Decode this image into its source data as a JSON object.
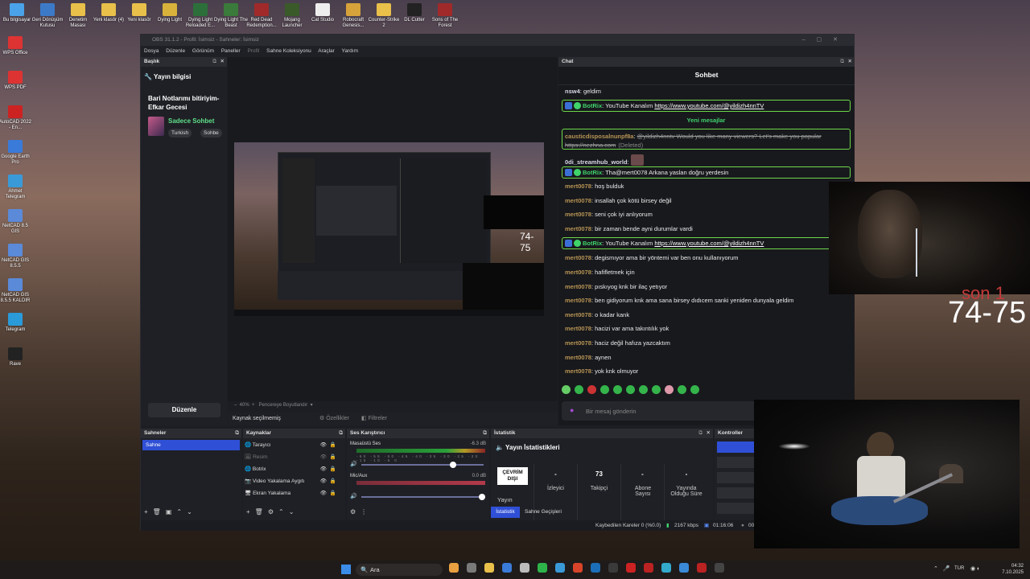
{
  "desktop": {
    "top_icons": [
      "Bu bilgisayar",
      "Geri Dönüşüm Kutusu",
      "Denetim Masası",
      "Yeni klasör (4)",
      "Yeni klasör",
      "Dying Light",
      "Dying Light Reloaded E...",
      "Dying Light The Beast",
      "Red Dead Redemption...",
      "Mojang Launcher",
      "Cat Studio",
      "Robocraft Genesis...",
      "Counter-Strike 2",
      "DL Cutter",
      "Sons of The Forest"
    ],
    "left_icons": [
      "WPS Office",
      "WPS PDF",
      "AutoCAD 2022 - En...",
      "Google Earth Pro",
      "Ahmet Telegram",
      "NetCAD 8.5 GIS",
      "NetCAD GIS 8.5.5",
      "NetCAD GIS 8.5.5 KALDIR",
      "Telegram",
      "Rave"
    ]
  },
  "obs": {
    "title": "OBS 31.1.2 - Profil: İsimsiz - Sahneler: İsimsiz",
    "menu": [
      "Dosya",
      "Düzenle",
      "Görünüm",
      "Paneller",
      "Profil",
      "Sahne Koleksiyonu",
      "Araçlar",
      "Yardım"
    ],
    "left_dock": {
      "header": "Başlık",
      "section_title": "Yayın bilgisi",
      "stream_title": "Bari Notlarımı bitiriyim-Efkar Gecesi",
      "category": "Sadece Sohbet",
      "tags": [
        "Turkish",
        "Sohbe"
      ],
      "edit_button": "Düzenle"
    },
    "preview": {
      "overlay_text": "74-75",
      "zoom": "40%",
      "fit_label": "Pencereye Boyutlandır",
      "no_source": "Kaynak seçilmemiş",
      "properties": "Özellikler",
      "filters": "Filtreler"
    },
    "chat": {
      "header": "Chat",
      "title": "Sohbet",
      "new_messages": "Yeni mesajlar",
      "input_placeholder": "Bir mesaj gönderin",
      "messages": [
        {
          "user": "nsw4",
          "text": "geldim"
        },
        {
          "user": "BotRix",
          "text": "YouTube Kanalım ",
          "link": "https://www.youtube.com/@yildizh4nnTV"
        },
        {
          "user": "causticdisposalnunpf8a",
          "text": "@yildizh4nntv Would you like many viewers? Let's make you popular https://nezhna.com",
          "note": "(Deleted)"
        },
        {
          "user": "0di_streamhub_world",
          "text": ""
        },
        {
          "user": "BotRix",
          "text": "Tha@mert0078 Arkana yaslan doğru yerdesin"
        },
        {
          "user": "mert0078",
          "text": "hoş bulduk"
        },
        {
          "user": "mert0078",
          "text": "insallah çok kötü birsey değil"
        },
        {
          "user": "mert0078",
          "text": "seni çok iyi anlıyorum"
        },
        {
          "user": "mert0078",
          "text": "bir zaman bende ayni durumlar vardi"
        },
        {
          "user": "BotRix",
          "text": "YouTube Kanalım ",
          "link": "https://www.youtube.com/@yildizh4nnTV"
        },
        {
          "user": "mert0078",
          "text": "degismıyor ama bir yöntemi var ben onu kullanıyorum"
        },
        {
          "user": "mert0078",
          "text": "hafifletmek için"
        },
        {
          "user": "mert0078",
          "text": "pıskıyog knk bir ilaç yetıyor"
        },
        {
          "user": "mert0078",
          "text": "ben gidiyorum knk ama sana birsey dıdıcem sanki yeniden dunyala geldim"
        },
        {
          "user": "mert0078",
          "text": "o kadar kank"
        },
        {
          "user": "mert0078",
          "text": "hacizi var ama takıntılık yok"
        },
        {
          "user": "mert0078",
          "text": "haciz değil hafıza yazcaktım"
        },
        {
          "user": "mert0078",
          "text": "aynen"
        },
        {
          "user": "mert0078",
          "text": "yok knk olmuyor"
        }
      ]
    },
    "scenes": {
      "header": "Sahneler",
      "items": [
        "Sahne"
      ]
    },
    "sources": {
      "header": "Kaynaklar",
      "items": [
        "Tarayıcı",
        "Resim",
        "Botrix",
        "Video Yakalama Aygıtı",
        "Ekran Yakalama"
      ]
    },
    "mixer": {
      "header": "Ses Karıştırıcı",
      "channels": [
        {
          "name": "Masaüstü Ses",
          "db": "-6.3 dB"
        },
        {
          "name": "Mic/Aux",
          "db": "0.0 dB"
        }
      ],
      "ticks": [
        "-60",
        "-55",
        "-50",
        "-45",
        "-40",
        "-35",
        "-30",
        "-25",
        "-20",
        "-15",
        "-10",
        "-5",
        "0"
      ]
    },
    "stats": {
      "header": "İstatistik",
      "title": "Yayın İstatistikleri",
      "offline": "ÇEVRİM DIŞI",
      "items": [
        {
          "label": "Yayın",
          "value": ""
        },
        {
          "label": "İzleyici",
          "value": "-"
        },
        {
          "label": "Takipçi",
          "value": "73"
        },
        {
          "label": "Abone Sayısı",
          "value": "-"
        },
        {
          "label": "Yayında Olduğu Süre",
          "value": "-"
        }
      ],
      "tabs": [
        "İstatistik",
        "Sahne Geçişleri"
      ]
    },
    "controls": {
      "header": "Kontroller"
    },
    "statusbar": {
      "dropped": "Kaybedilen Kareler 0 (%0.0)",
      "kbps": "2167 kbps",
      "time": "01:16:06",
      "time2": "00"
    }
  },
  "overlay": {
    "son_text": "son 1",
    "score": "74-75"
  },
  "taskbar": {
    "search": "Ara",
    "lang": "TUR",
    "time": "04:32",
    "date": "7.10.2025"
  },
  "colors": {
    "accent": "#3b5bdb",
    "chat_user": "#b79454",
    "bot_green": "#3fd36a",
    "bot_border": "#6dd84a"
  }
}
